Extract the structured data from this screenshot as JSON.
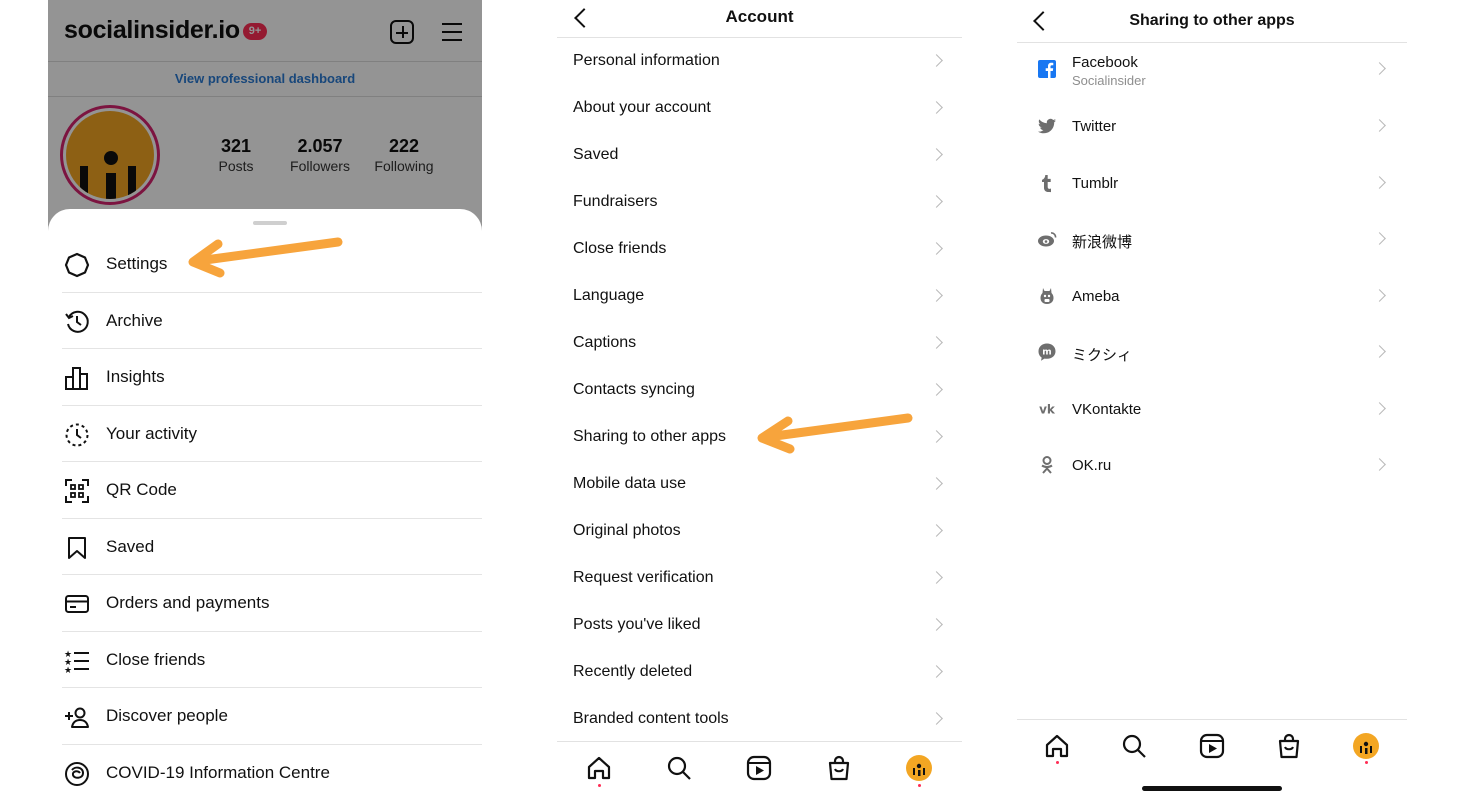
{
  "profile_screen": {
    "brand": "socialinsider.io",
    "notification_badge": "9+",
    "pro_dashboard_link": "View professional dashboard",
    "stats": [
      {
        "value": "321",
        "label": "Posts"
      },
      {
        "value": "2.057",
        "label": "Followers"
      },
      {
        "value": "222",
        "label": "Following"
      }
    ],
    "menu": [
      {
        "label": "Settings",
        "icon": "settings-icon"
      },
      {
        "label": "Archive",
        "icon": "archive-icon"
      },
      {
        "label": "Insights",
        "icon": "insights-icon"
      },
      {
        "label": "Your activity",
        "icon": "activity-icon"
      },
      {
        "label": "QR Code",
        "icon": "qr-code-icon"
      },
      {
        "label": "Saved",
        "icon": "bookmark-icon"
      },
      {
        "label": "Orders and payments",
        "icon": "card-icon"
      },
      {
        "label": "Close friends",
        "icon": "close-friends-icon"
      },
      {
        "label": "Discover people",
        "icon": "add-person-icon"
      },
      {
        "label": "COVID-19 Information Centre",
        "icon": "covid-icon"
      }
    ]
  },
  "account_screen": {
    "title": "Account",
    "items": [
      "Personal information",
      "About your account",
      "Saved",
      "Fundraisers",
      "Close friends",
      "Language",
      "Captions",
      "Contacts syncing",
      "Sharing to other apps",
      "Mobile data use",
      "Original photos",
      "Request verification",
      "Posts you've liked",
      "Recently deleted",
      "Branded content tools"
    ]
  },
  "sharing_screen": {
    "title": "Sharing to other apps",
    "apps": [
      {
        "name": "Facebook",
        "account": "Socialinsider",
        "icon": "facebook-icon"
      },
      {
        "name": "Twitter",
        "icon": "twitter-icon"
      },
      {
        "name": "Tumblr",
        "icon": "tumblr-icon"
      },
      {
        "name": "新浪微博",
        "icon": "weibo-icon"
      },
      {
        "name": "Ameba",
        "icon": "ameba-icon"
      },
      {
        "name": "ミクシィ",
        "icon": "mixi-icon"
      },
      {
        "name": "VKontakte",
        "icon": "vk-icon"
      },
      {
        "name": "OK.ru",
        "icon": "ok-icon"
      }
    ]
  },
  "tabbar": [
    "home-icon",
    "search-icon",
    "reels-icon",
    "shop-icon",
    "profile-avatar"
  ],
  "colors": {
    "arrow": "#f7a43c",
    "avatar": "#f3a623",
    "badge": "#ff2d55",
    "link": "#2a7bd4",
    "facebook": "#1877f2"
  }
}
